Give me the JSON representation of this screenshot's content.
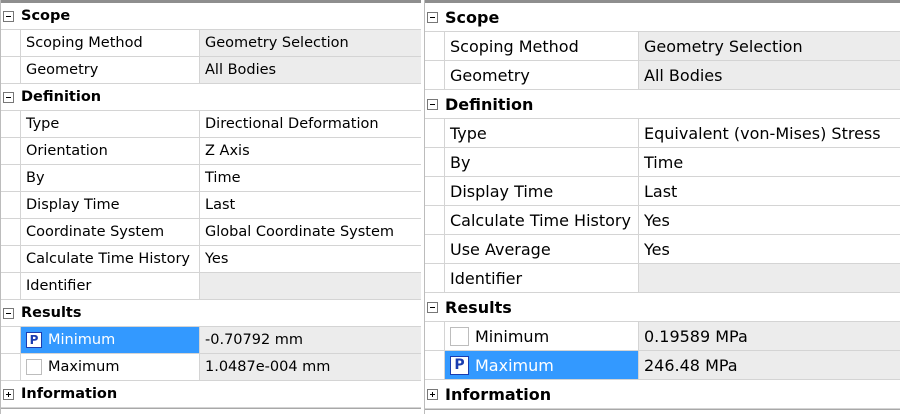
{
  "left": {
    "scope": {
      "title": "Scope",
      "rows": [
        {
          "label": "Scoping Method",
          "value": "Geometry Selection"
        },
        {
          "label": "Geometry",
          "value": "All Bodies"
        }
      ]
    },
    "definition": {
      "title": "Definition",
      "rows": [
        {
          "label": "Type",
          "value": "Directional Deformation"
        },
        {
          "label": "Orientation",
          "value": "Z Axis"
        },
        {
          "label": "By",
          "value": "Time"
        },
        {
          "label": "Display Time",
          "value": "Last"
        },
        {
          "label": "Coordinate System",
          "value": "Global Coordinate System"
        },
        {
          "label": "Calculate Time History",
          "value": "Yes"
        },
        {
          "label": "Identifier",
          "value": ""
        }
      ]
    },
    "results": {
      "title": "Results",
      "rows": [
        {
          "label": "Minimum",
          "value": "-0.70792 mm",
          "badge": "P",
          "selected": true
        },
        {
          "label": "Maximum",
          "value": "1.0487e-004 mm",
          "badge": "",
          "selected": false
        }
      ]
    },
    "information": {
      "title": "Information"
    }
  },
  "right": {
    "scope": {
      "title": "Scope",
      "rows": [
        {
          "label": "Scoping Method",
          "value": "Geometry Selection"
        },
        {
          "label": "Geometry",
          "value": "All Bodies"
        }
      ]
    },
    "definition": {
      "title": "Definition",
      "rows": [
        {
          "label": "Type",
          "value": "Equivalent (von-Mises) Stress"
        },
        {
          "label": "By",
          "value": "Time"
        },
        {
          "label": "Display Time",
          "value": "Last"
        },
        {
          "label": "Calculate Time History",
          "value": "Yes"
        },
        {
          "label": "Use Average",
          "value": "Yes"
        },
        {
          "label": "Identifier",
          "value": ""
        }
      ]
    },
    "results": {
      "title": "Results",
      "rows": [
        {
          "label": "Minimum",
          "value": "0.19589 MPa",
          "badge": "",
          "selected": false
        },
        {
          "label": "Maximum",
          "value": "246.48 MPa",
          "badge": "P",
          "selected": true
        }
      ]
    },
    "information": {
      "title": "Information"
    }
  },
  "colors": {
    "selection": "#3399ff",
    "value_bg": "#ececec",
    "badge_text": "#1a3cb0"
  }
}
